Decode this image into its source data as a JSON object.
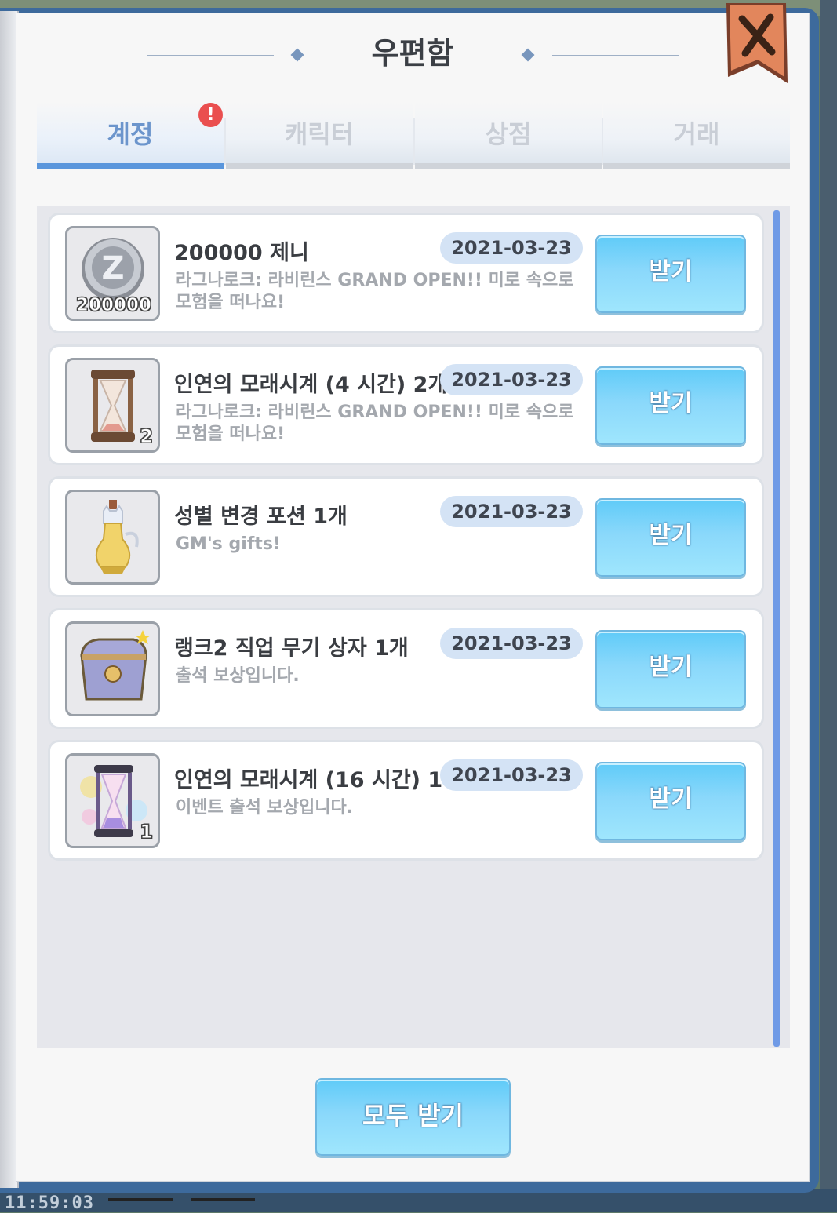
{
  "window": {
    "title": "우편함",
    "close_icon": "x-close-icon"
  },
  "tabs": [
    {
      "label": "계정",
      "active": true,
      "badge": "!"
    },
    {
      "label": "캐릭터",
      "active": false
    },
    {
      "label": "상점",
      "active": false
    },
    {
      "label": "거래",
      "active": false
    }
  ],
  "mails": [
    {
      "title": "200000 제니",
      "date": "2021-03-23",
      "desc": "라그나로크: 라비린스 GRAND OPEN!! 미로 속으로 모험을 떠나요!",
      "button": "받기",
      "icon": "zeny-coin-icon",
      "qty": "200000"
    },
    {
      "title": "인연의 모래시계 (4 시간) 2개",
      "date": "2021-03-23",
      "desc": "라그나로크: 라비린스 GRAND OPEN!! 미로 속으로 모험을 떠나요!",
      "button": "받기",
      "icon": "hourglass-icon",
      "qty": "2"
    },
    {
      "title": "성별 변경 포션 1개",
      "date": "2021-03-23",
      "desc": "GM's gifts!",
      "button": "받기",
      "icon": "cat-potion-icon",
      "qty": ""
    },
    {
      "title": "랭크2 직업 무기 상자 1개",
      "date": "2021-03-23",
      "desc": "출석 보상입니다.",
      "button": "받기",
      "icon": "treasure-chest-icon",
      "qty": ""
    },
    {
      "title": "인연의 모래시계 (16 시간) 1개",
      "date": "2021-03-23",
      "desc": "이벤트 출석 보상입니다.",
      "button": "받기",
      "icon": "rainbow-hourglass-icon",
      "qty": "1"
    }
  ],
  "footer": {
    "claim_all": "모두 받기"
  },
  "status": {
    "clock": "11:59:03"
  },
  "colors": {
    "accent": "#5a96dc",
    "button": "#7fd6fa",
    "badge": "#ea4f4f"
  }
}
